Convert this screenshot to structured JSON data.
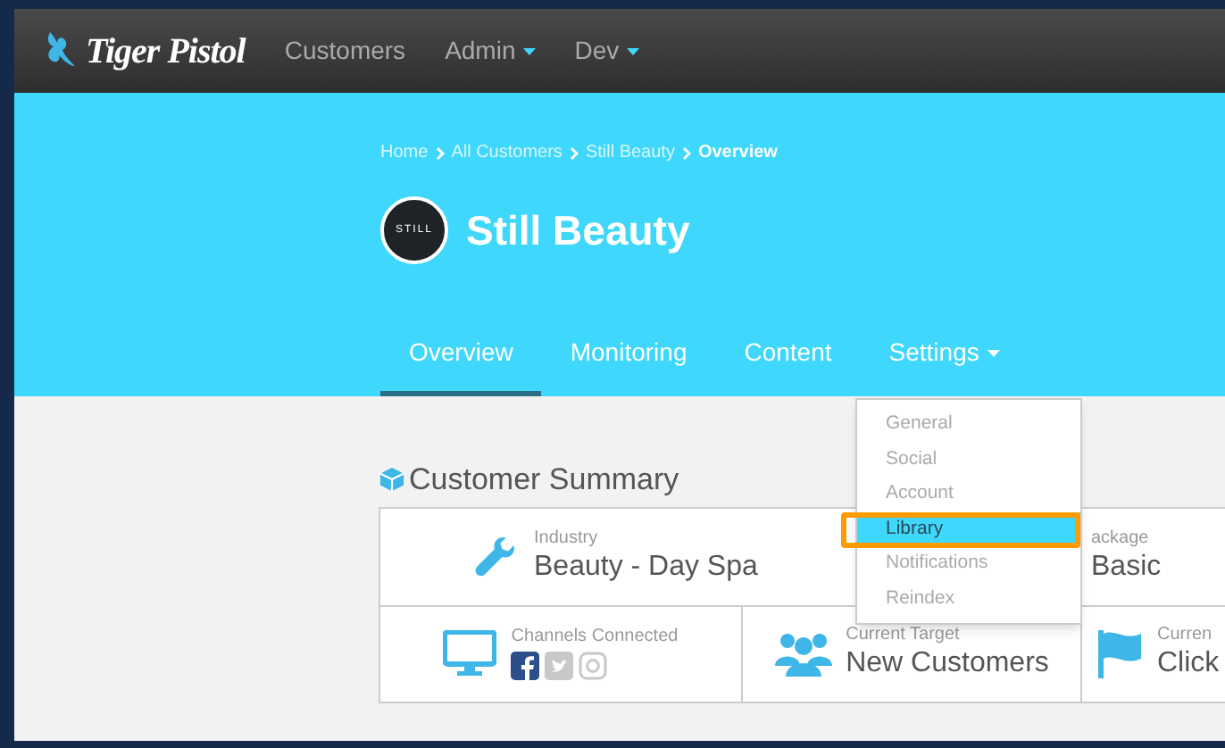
{
  "nav": {
    "logo": "Tiger Pistol",
    "items": [
      {
        "label": "Customers",
        "dropdown": false
      },
      {
        "label": "Admin",
        "dropdown": true
      },
      {
        "label": "Dev",
        "dropdown": true
      }
    ]
  },
  "breadcrumb": [
    {
      "label": "Home",
      "current": false
    },
    {
      "label": "All Customers",
      "current": false
    },
    {
      "label": "Still Beauty",
      "current": false
    },
    {
      "label": "Overview",
      "current": true
    }
  ],
  "customer": {
    "logo_text": "STILL",
    "name": "Still Beauty"
  },
  "tabs": [
    {
      "label": "Overview",
      "selected": true,
      "dropdown": false
    },
    {
      "label": "Monitoring",
      "selected": false,
      "dropdown": false
    },
    {
      "label": "Content",
      "selected": false,
      "dropdown": false
    },
    {
      "label": "Settings",
      "selected": false,
      "dropdown": true
    }
  ],
  "settings_menu": [
    {
      "label": "General",
      "selected": false
    },
    {
      "label": "Social",
      "selected": false
    },
    {
      "label": "Account",
      "selected": false
    },
    {
      "label": "Library",
      "selected": true
    },
    {
      "label": "Notifications",
      "selected": false
    },
    {
      "label": "Reindex",
      "selected": false
    }
  ],
  "summary": {
    "title": "Customer Summary",
    "rows": [
      [
        {
          "label": "Industry",
          "value": "Beauty - Day Spa"
        },
        {
          "label": "ackage",
          "value": "Basic"
        }
      ],
      [
        {
          "label": "Channels Connected",
          "channels": [
            {
              "connected": true
            },
            {
              "connected": false
            },
            {
              "connected": false
            }
          ]
        },
        {
          "label": "Current Target",
          "value": "New Customers"
        },
        {
          "label": "Curren",
          "value": "Click"
        }
      ]
    ]
  }
}
